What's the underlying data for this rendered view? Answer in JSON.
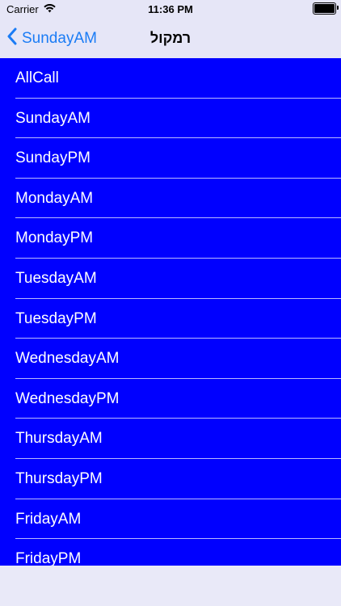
{
  "status_bar": {
    "carrier": "Carrier",
    "time": "11:36 PM"
  },
  "nav": {
    "back_label": "SundayAM",
    "title": "רמקול"
  },
  "list": {
    "items": [
      "AllCall",
      "SundayAM",
      "SundayPM",
      "MondayAM",
      "MondayPM",
      "TuesdayAM",
      "TuesdayPM",
      "WednesdayAM",
      "WednesdayPM",
      "ThursdayAM",
      "ThursdayPM",
      "FridayAM",
      "FridayPM"
    ]
  },
  "colors": {
    "list_background": "#0000ff",
    "accent": "#1b7cf5",
    "bar_background": "#e6e6f7"
  },
  "icons": {
    "signal": "wifi-icon",
    "battery": "battery-icon",
    "back": "chevron-left-icon"
  }
}
